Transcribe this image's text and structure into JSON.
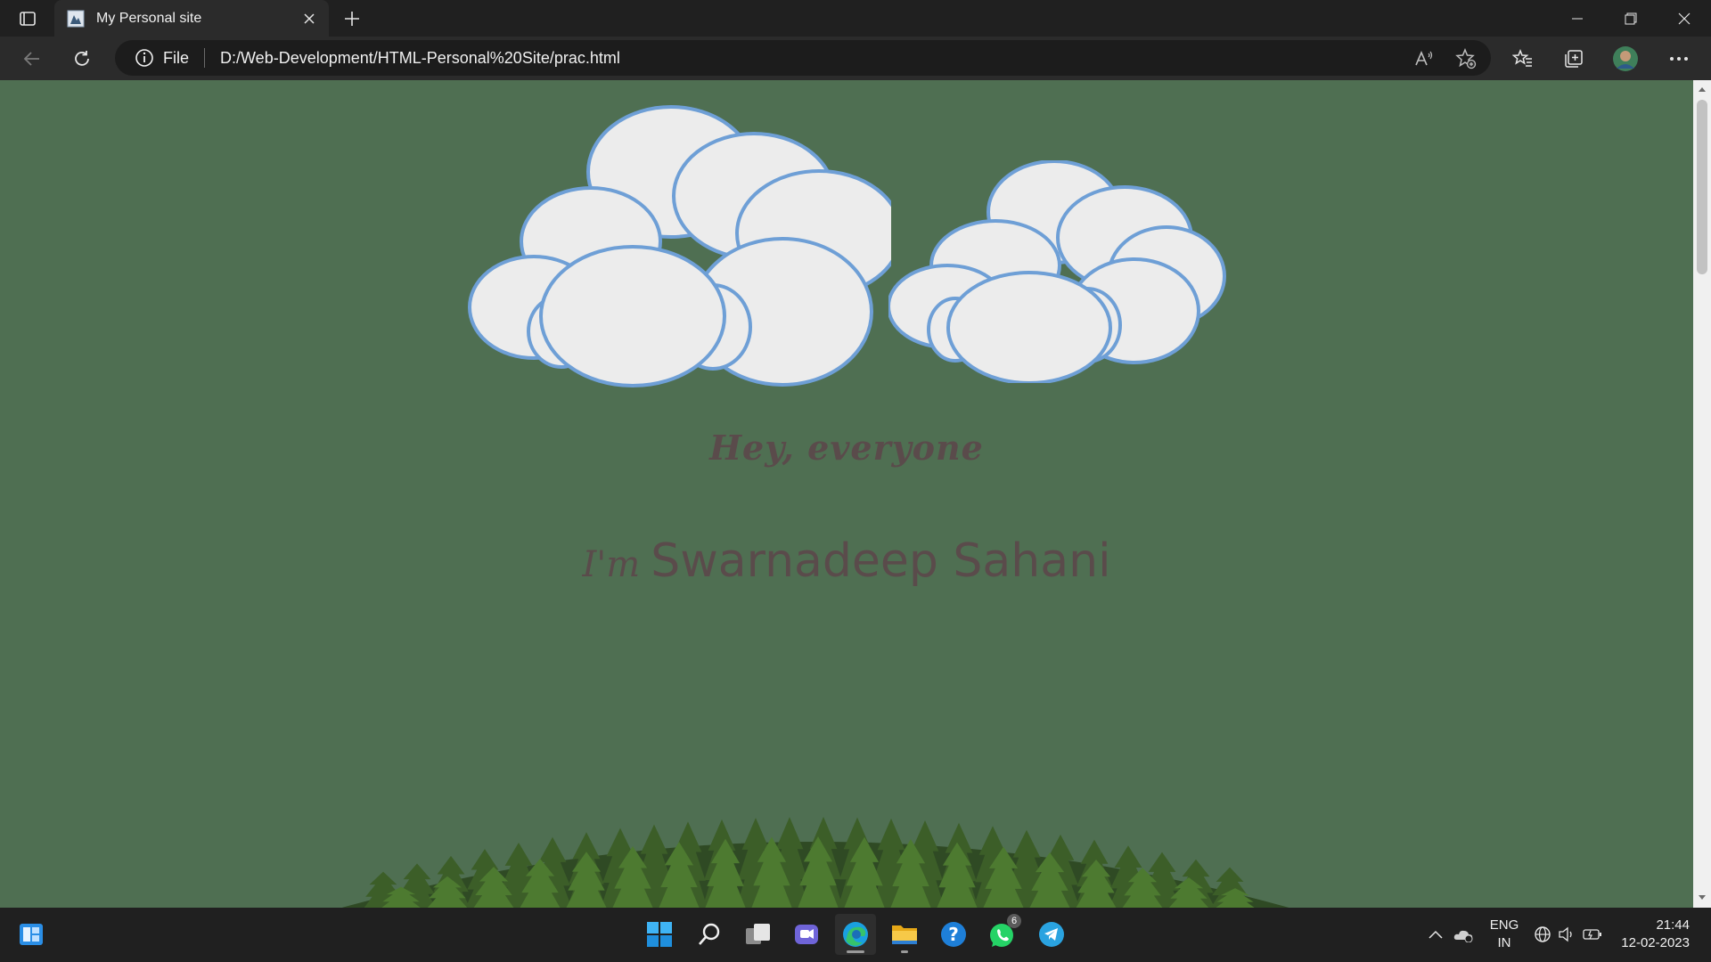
{
  "browser": {
    "tab_title": "My Personal site",
    "address_site_label": "File",
    "url": "D:/Web-Development/HTML-Personal%20Site/prac.html"
  },
  "page": {
    "greeting": "Hey, everyone",
    "intro_prefix": "I'm",
    "name": "Swarnadeep Sahani",
    "colors": {
      "background": "#4f6f52",
      "text": "#5a4b4b",
      "cloud_fill": "#ececec",
      "cloud_stroke": "#6e9fd6"
    }
  },
  "taskbar": {
    "whatsapp_badge": "6",
    "language_line1": "ENG",
    "language_line2": "IN",
    "time": "21:44",
    "date": "12-02-2023",
    "icons": [
      "widgets-icon",
      "windows-start-icon",
      "search-icon",
      "task-view-icon",
      "teams-chat-icon",
      "edge-icon",
      "file-explorer-icon",
      "help-icon",
      "whatsapp-icon",
      "telegram-icon"
    ]
  }
}
